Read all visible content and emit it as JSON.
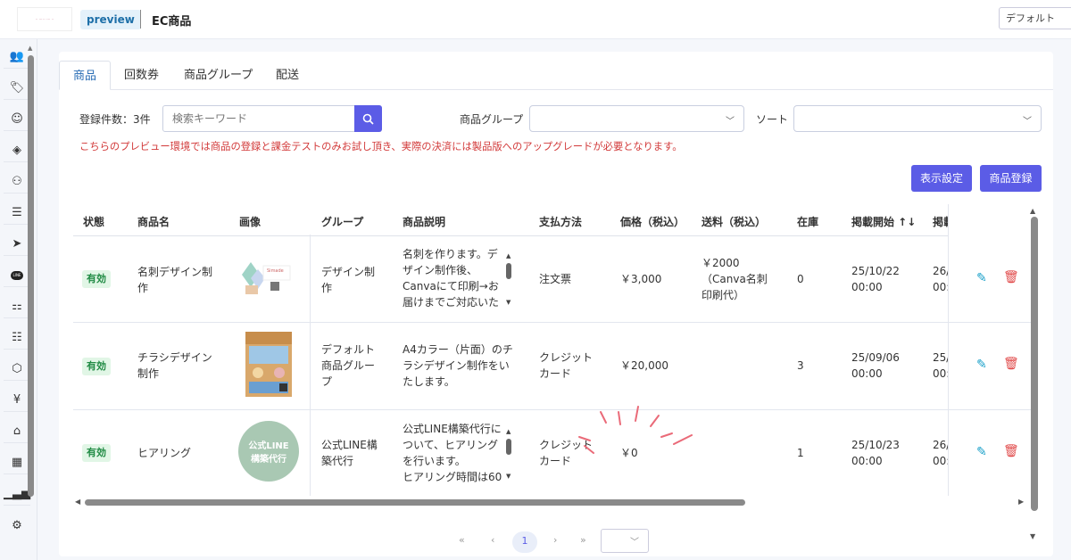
{
  "app": {
    "preview_label": "preview",
    "page_title": "EC商品",
    "language": "デフォルト"
  },
  "tabs": [
    "商品",
    "回数券",
    "商品グループ",
    "配送"
  ],
  "toolbar": {
    "count_label": "登録件数：3件",
    "search_placeholder": "検索キーワード",
    "group_label": "商品グループ",
    "sort_label": "ソート",
    "notice": "こちらのプレビュー環境では商品の登録と課金テストのみお試し頂き、実際の決済には製品版へのアップグレードが必要となります。",
    "display_settings": "表示設定",
    "register": "商品登録"
  },
  "columns": [
    "状態",
    "商品名",
    "画像",
    "グループ",
    "商品説明",
    "支払方法",
    "価格（税込）",
    "送料（税込）",
    "在庫",
    "掲載開始 ↑↓",
    "掲載"
  ],
  "rows": [
    {
      "status": "有効",
      "name": [
        "名刺デザイン制",
        "作"
      ],
      "group": [
        "デザイン制",
        "作"
      ],
      "desc": [
        "名刺を作ります。デ",
        "ザイン制作後、",
        "Canvaにて印刷→お",
        "届けまでご対応いた"
      ],
      "payment": [
        "注文票"
      ],
      "price": "￥3,000",
      "shipping": [
        "￥2000",
        "（Canva名刺",
        "印刷代）"
      ],
      "stock": "0",
      "start": [
        "25/10/22",
        "00:00"
      ],
      "end": [
        "26/",
        "00:"
      ]
    },
    {
      "status": "有効",
      "name": [
        "チラシデザイン",
        "制作"
      ],
      "group": [
        "デフォルト",
        "商品グルー",
        "プ"
      ],
      "desc": [
        "A4カラー（片面）のチ",
        "ラシデザイン制作をい",
        "たします。"
      ],
      "payment": [
        "クレジット",
        "カード"
      ],
      "price": "￥20,000",
      "shipping": [],
      "stock": "3",
      "start": [
        "25/09/06",
        "00:00"
      ],
      "end": [
        "25/",
        "00:"
      ]
    },
    {
      "status": "有効",
      "name": [
        "ヒアリング"
      ],
      "group": [
        "公式LINE構",
        "築代行"
      ],
      "desc": [
        "公式LINE構築代行に",
        "ついて、ヒアリング",
        "を行います。",
        "ヒアリング時間は60"
      ],
      "payment": [
        "クレジット",
        "カード"
      ],
      "price": "￥0",
      "shipping": [],
      "stock": "1",
      "start": [
        "25/10/23",
        "00:00"
      ],
      "end": [
        "26/",
        "00:"
      ]
    }
  ],
  "thumb3": [
    "公式LINE",
    "構築代行"
  ],
  "pagination": {
    "page": "1"
  }
}
